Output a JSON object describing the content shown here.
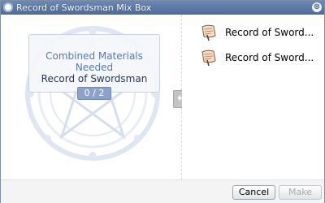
{
  "window": {
    "title": "Record of Swordsman Mix Box",
    "close_symbol": "⊗"
  },
  "left_panel": {
    "heading": "Combined Materials Needed",
    "item_name": "Record of Swordsman",
    "counter": "0 / 2"
  },
  "arrow_icon": "arrow-left-icon",
  "arrow_symbol": "←",
  "materials": [
    {
      "label": "Record of Sword...",
      "icon": "scroll-icon"
    },
    {
      "label": "Record of Sword...",
      "icon": "scroll-icon"
    }
  ],
  "buttons": {
    "cancel_label": "Cancel",
    "make_label": "Make"
  },
  "colors": {
    "title_bar": "#5a77a6",
    "heading_text": "#5a79ad",
    "counter_bg": "#8ba3cc",
    "disabled_text": "#a9a9a9"
  }
}
